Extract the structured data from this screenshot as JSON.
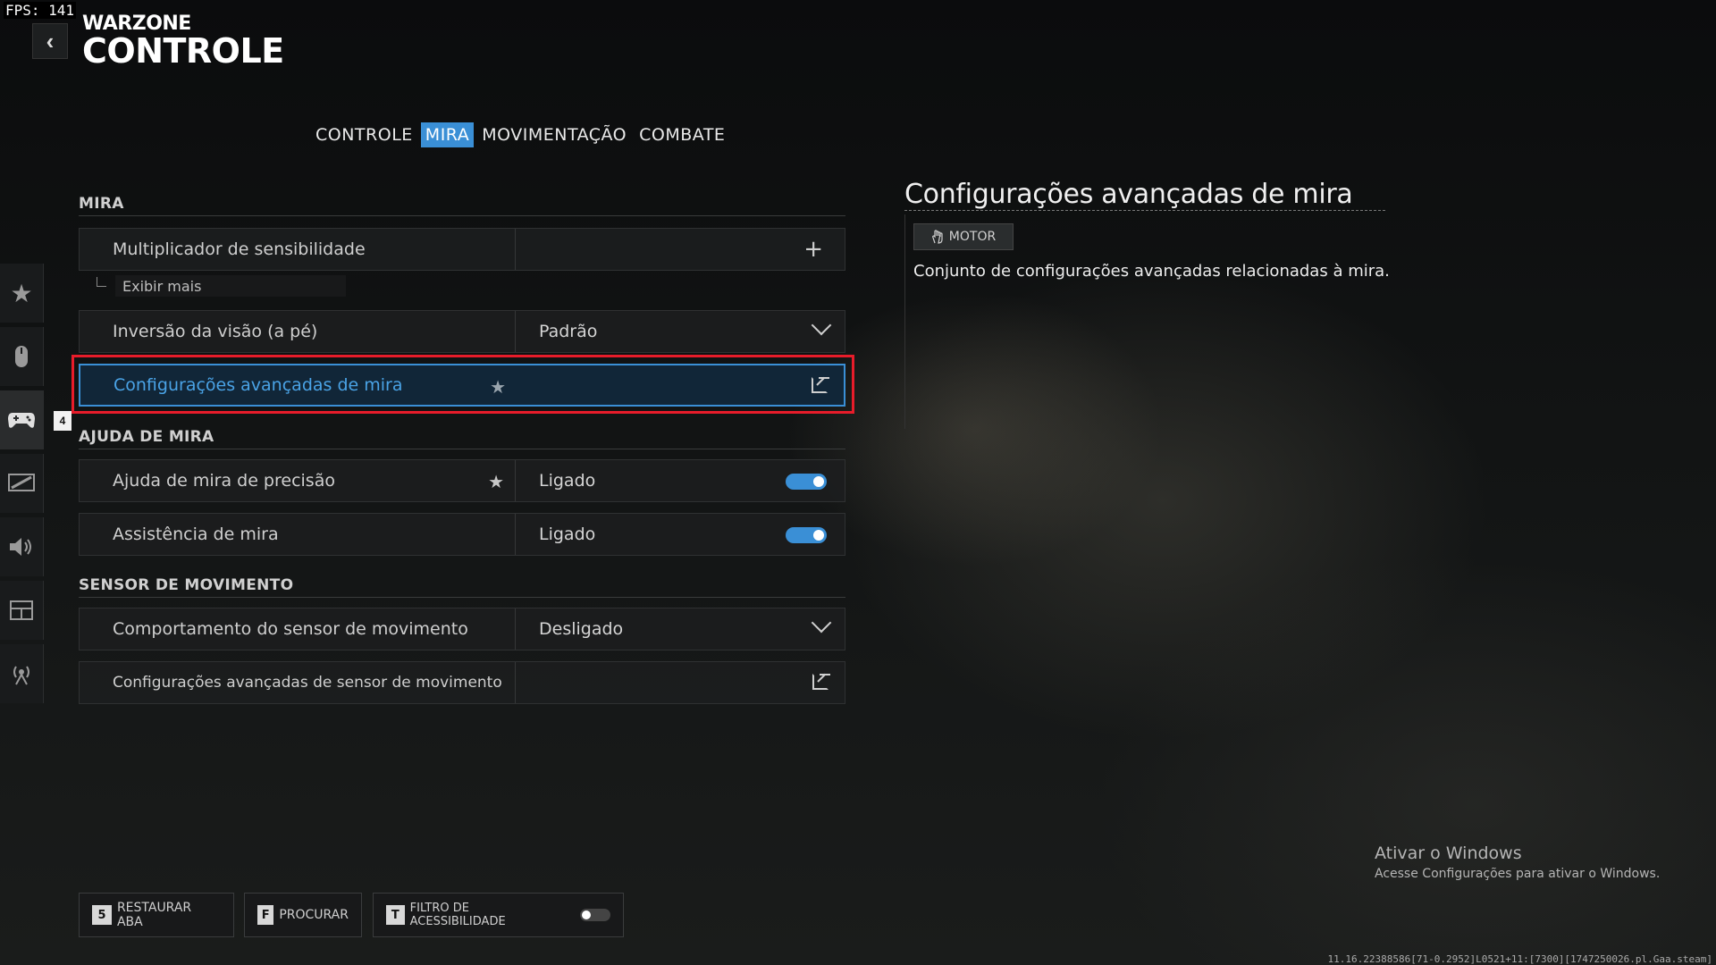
{
  "fps_counter": "FPS: 141",
  "header": {
    "brand_small": "WARZONE",
    "brand_big": "CONTROLE",
    "back_icon": "chevron-left-icon"
  },
  "sidebar": {
    "items": [
      {
        "icon": "star-icon"
      },
      {
        "icon": "mouse-icon"
      },
      {
        "icon": "gamepad-icon"
      },
      {
        "icon": "display-icon"
      },
      {
        "icon": "speaker-icon"
      },
      {
        "icon": "interface-icon"
      },
      {
        "icon": "network-icon"
      }
    ],
    "badge": "4"
  },
  "tabs": [
    {
      "label": "CONTROLE",
      "active": false
    },
    {
      "label": "MIRA",
      "active": true
    },
    {
      "label": "MOVIMENTAÇÃO",
      "active": false
    },
    {
      "label": "COMBATE",
      "active": false
    }
  ],
  "sections": {
    "mira": {
      "title": "MIRA",
      "rows": [
        {
          "label": "Multiplicador de sensibilidade",
          "value": ""
        },
        {
          "label": "Inversão da visão (a pé)",
          "value": "Padrão"
        },
        {
          "label": "Configurações avançadas de mira",
          "value": ""
        }
      ],
      "show_more": "Exibir mais"
    },
    "ajuda": {
      "title": "AJUDA DE MIRA",
      "rows": [
        {
          "label": "Ajuda de mira de precisão",
          "value": "Ligado"
        },
        {
          "label": "Assistência de mira",
          "value": "Ligado"
        }
      ]
    },
    "sensor": {
      "title": "SENSOR DE MOVIMENTO",
      "rows": [
        {
          "label": "Comportamento do sensor de movimento",
          "value": "Desligado"
        },
        {
          "label": "Configurações avançadas de sensor de movimento",
          "value": ""
        }
      ]
    }
  },
  "detail": {
    "title": "Configurações avançadas de mira",
    "tag": "MOTOR",
    "description": "Conjunto de configurações avançadas relacionadas à mira."
  },
  "bottom_bar": {
    "restore": {
      "key": "5",
      "label": "RESTAURAR ABA"
    },
    "search": {
      "key": "F",
      "label": "PROCURAR"
    },
    "filter": {
      "key": "T",
      "label": "FILTRO DE ACESSIBILIDADE"
    }
  },
  "windows_watermark": {
    "title": "Ativar o Windows",
    "subtitle": "Acesse Configurações para ativar o Windows."
  },
  "version_string": "11.16.22388586[71-0.2952]L0521+11:[7300][1747250026.pl.Gaa.steam]",
  "colors": {
    "accent": "#3a8fd6",
    "highlight_box": "#e81c2a"
  }
}
